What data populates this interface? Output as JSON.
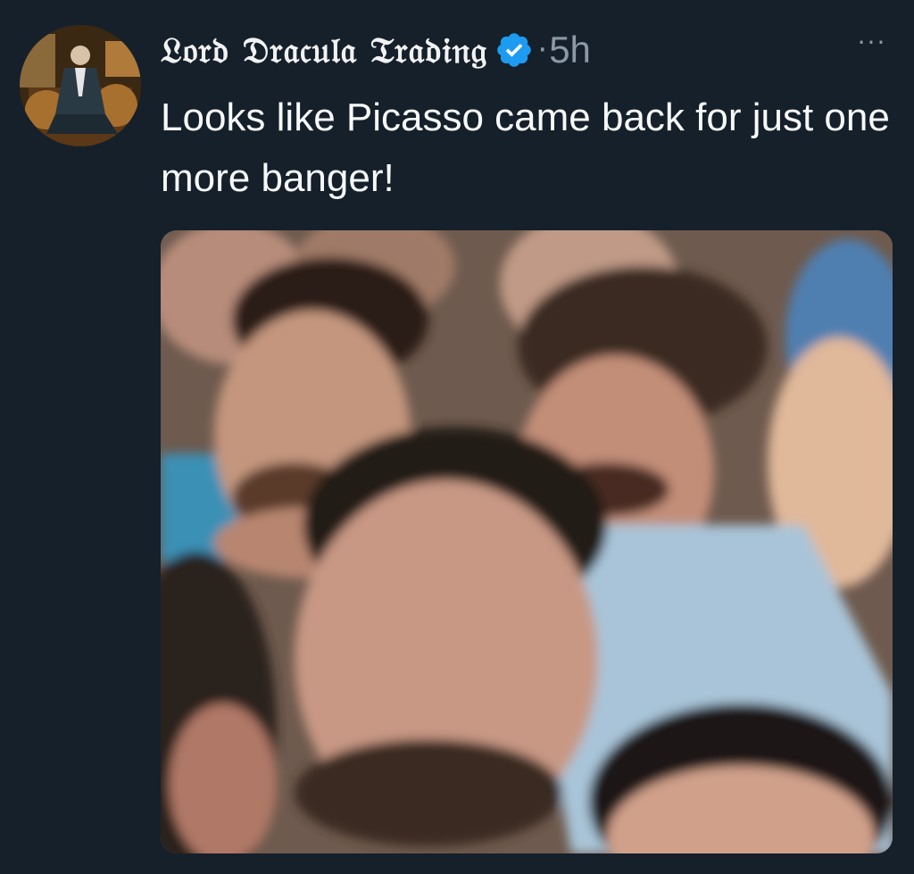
{
  "tweet": {
    "display_name": "𝔏𝔬𝔯𝔡 𝔇𝔯𝔞𝔠𝔲𝔩𝔞 𝔗𝔯𝔞𝔡𝔦𝔫𝔤",
    "separator": "·",
    "timestamp": "5h",
    "more_label": "···",
    "text": "Looks like Picasso came back for just one more banger!",
    "verified_icon": "verified-badge-icon",
    "media_alt": "Crowd photo"
  },
  "colors": {
    "background": "#15202b",
    "text": "#f7f9f9",
    "muted": "#8b98a5",
    "verified": "#1d9bf0"
  }
}
